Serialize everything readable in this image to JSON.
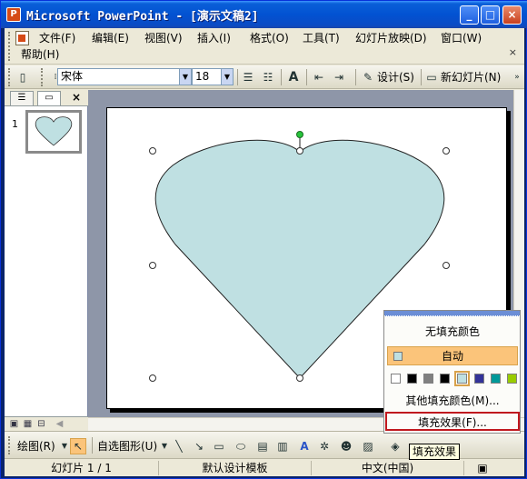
{
  "window": {
    "title": "Microsoft PowerPoint - [演示文稿2]",
    "min": "_",
    "max": "□",
    "close": "×"
  },
  "menu": {
    "items": [
      "文件(F)",
      "编辑(E)",
      "视图(V)",
      "插入(I)",
      "格式(O)",
      "工具(T)",
      "幻灯片放映(D)",
      "窗口(W)"
    ],
    "help": "帮助(H)",
    "close_x": "×"
  },
  "toolbar": {
    "font_name": "宋体",
    "font_size": "18",
    "design_label": "设计(S)",
    "new_slide_label": "新幻灯片(N)"
  },
  "left_pane": {
    "slide_number": "1",
    "close_x": "×"
  },
  "drawing_bar": {
    "draw_label": "绘图(R)",
    "autoshapes_label": "自选图形(U)"
  },
  "popup": {
    "no_fill": "无填充颜色",
    "auto": "自动",
    "more_colors": "其他填充颜色(M)...",
    "fill_effects": "填充效果(F)...",
    "swatch_colors": [
      "#ffffff",
      "#000000",
      "#808080",
      "#000000",
      "#bfe0e2",
      "#333399",
      "#009999",
      "#99cc00"
    ]
  },
  "tooltip": "填充效果",
  "status": {
    "slide": "幻灯片 1 / 1",
    "template": "默认设计模板",
    "language": "中文(中国)"
  },
  "colors": {
    "heart_fill": "#bfe0e2",
    "title_bar": "#0252d2",
    "highlight": "#c0181e"
  }
}
